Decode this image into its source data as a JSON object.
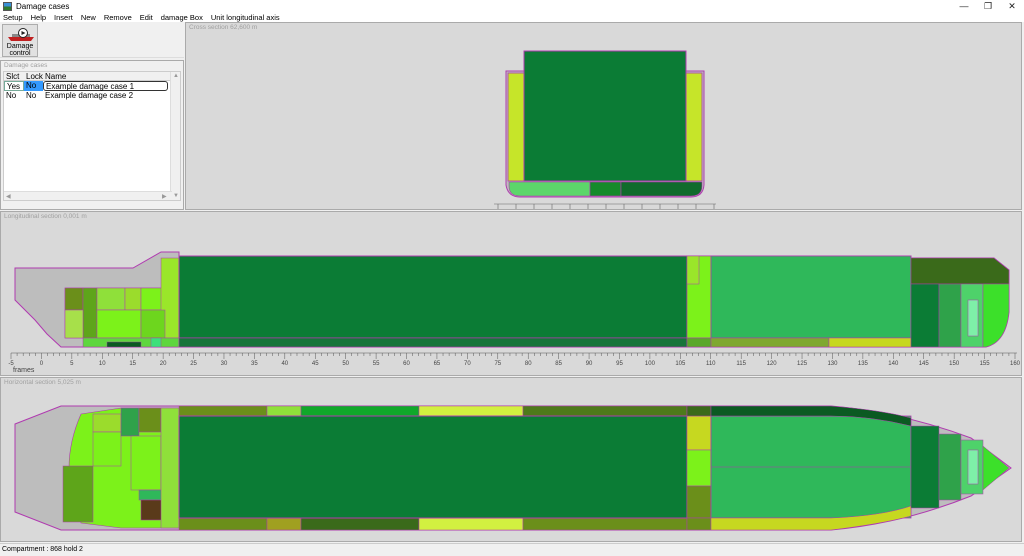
{
  "window": {
    "title": "Damage cases",
    "minimize": "—",
    "restore": "❐",
    "close": "✕"
  },
  "menu": [
    "Setup",
    "Help",
    "Insert",
    "New",
    "Remove",
    "Edit",
    "damage Box",
    "Unit longitudinal axis"
  ],
  "toolbar": {
    "button_line1": "Damage",
    "button_line2": "control",
    "icon": "damage-control-icon"
  },
  "damage_panel": {
    "title": "Damage cases",
    "columns": [
      "Slct",
      "Lock",
      "Name"
    ],
    "rows": [
      {
        "slct": "Yes",
        "lock": "No",
        "name": "Example damage case 1"
      },
      {
        "slct": "No",
        "lock": "No",
        "name": "Example damage case 2"
      }
    ]
  },
  "cross_section": {
    "title": "Cross section 62,600 m"
  },
  "longitudinal_section": {
    "title": "Longitudinal section 0,001 m",
    "axis_label": "frames",
    "ticks": [
      "-5",
      "0",
      "5",
      "10",
      "15",
      "20",
      "25",
      "30",
      "35",
      "40",
      "45",
      "50",
      "55",
      "60",
      "65",
      "70",
      "75",
      "80",
      "85",
      "90",
      "95",
      "100",
      "105",
      "110",
      "115",
      "120",
      "125",
      "130",
      "135",
      "140",
      "145",
      "150",
      "155",
      "160"
    ]
  },
  "horizontal_section": {
    "title": "Horizontal section 5,025 m"
  },
  "status": {
    "text": "Compartment : 868 hold 2"
  },
  "colors": {
    "hold": "#0b7c35",
    "light": "#7cf21a",
    "yellow": "#c6e529",
    "mid": "#2fb85a",
    "olive": "#6b8f1a",
    "outline": "#b03ab0",
    "hull": "#bdbdbd"
  }
}
